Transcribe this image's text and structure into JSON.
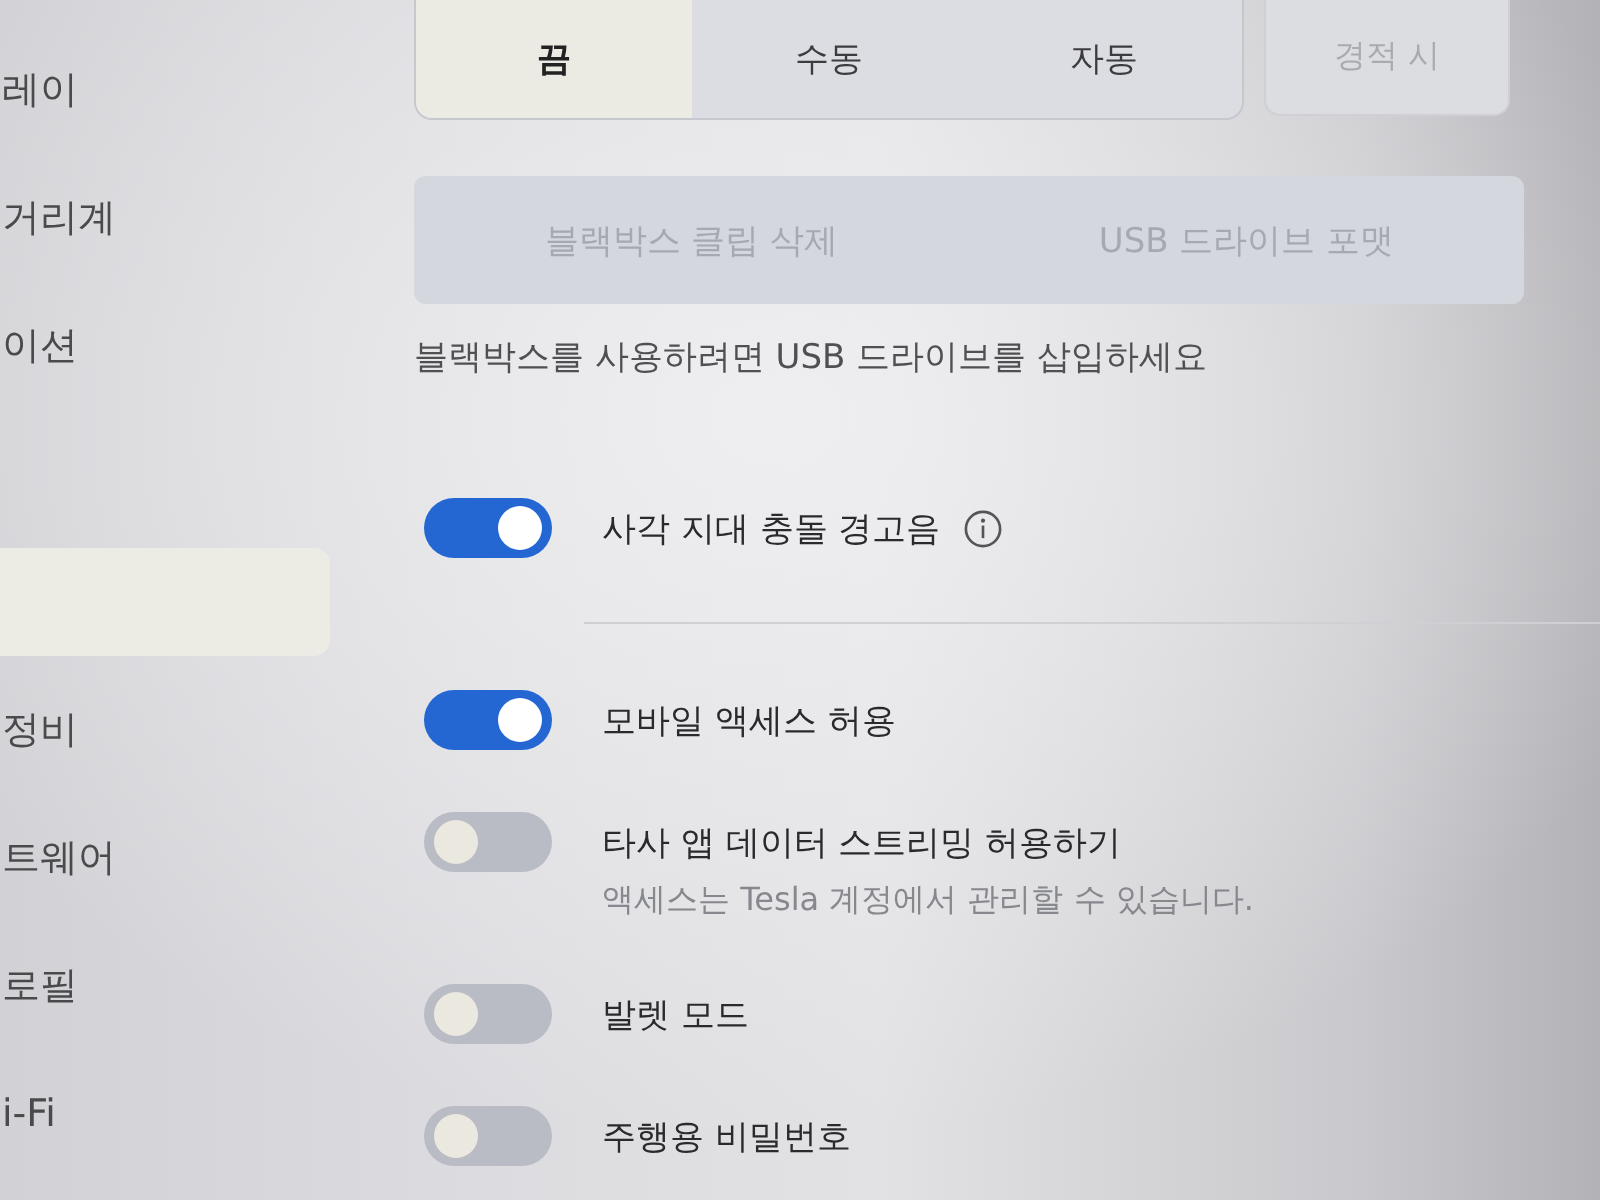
{
  "sidebar": {
    "items": [
      {
        "label": "레이",
        "selected": false
      },
      {
        "label": "거리계",
        "selected": false
      },
      {
        "label": "이션",
        "selected": false
      },
      {
        "selected": true
      },
      {
        "label": "정비",
        "selected": false
      },
      {
        "label": "트웨어",
        "selected": false
      },
      {
        "label": "로필",
        "selected": false
      },
      {
        "label": "i-Fi",
        "selected": false
      }
    ]
  },
  "dashcam": {
    "modes": [
      {
        "label": "끔",
        "selected": true
      },
      {
        "label": "수동",
        "selected": false
      },
      {
        "label": "자동",
        "selected": false
      }
    ],
    "honk_button": {
      "label": "경적 시",
      "disabled": true
    },
    "actions": [
      {
        "label": "블랙박스 클립 삭제",
        "disabled": true
      },
      {
        "label": "USB 드라이브 포맷",
        "disabled": true
      }
    ],
    "notice": "블랙박스를 사용하려면 USB 드라이브를 삽입하세요"
  },
  "settings_groups": [
    [
      {
        "label": "사각 지대 충돌 경고음",
        "on": true,
        "info": true
      }
    ],
    [
      {
        "label": "모바일 액세스 허용",
        "on": true
      },
      {
        "label": "타사 앱 데이터 스트리밍 허용하기",
        "on": false,
        "description": "액세스는 Tesla 계정에서 관리할 수 있습니다."
      },
      {
        "label": "발렛 모드",
        "on": false
      },
      {
        "label": "주행용 비밀번호",
        "on": false
      }
    ]
  ]
}
